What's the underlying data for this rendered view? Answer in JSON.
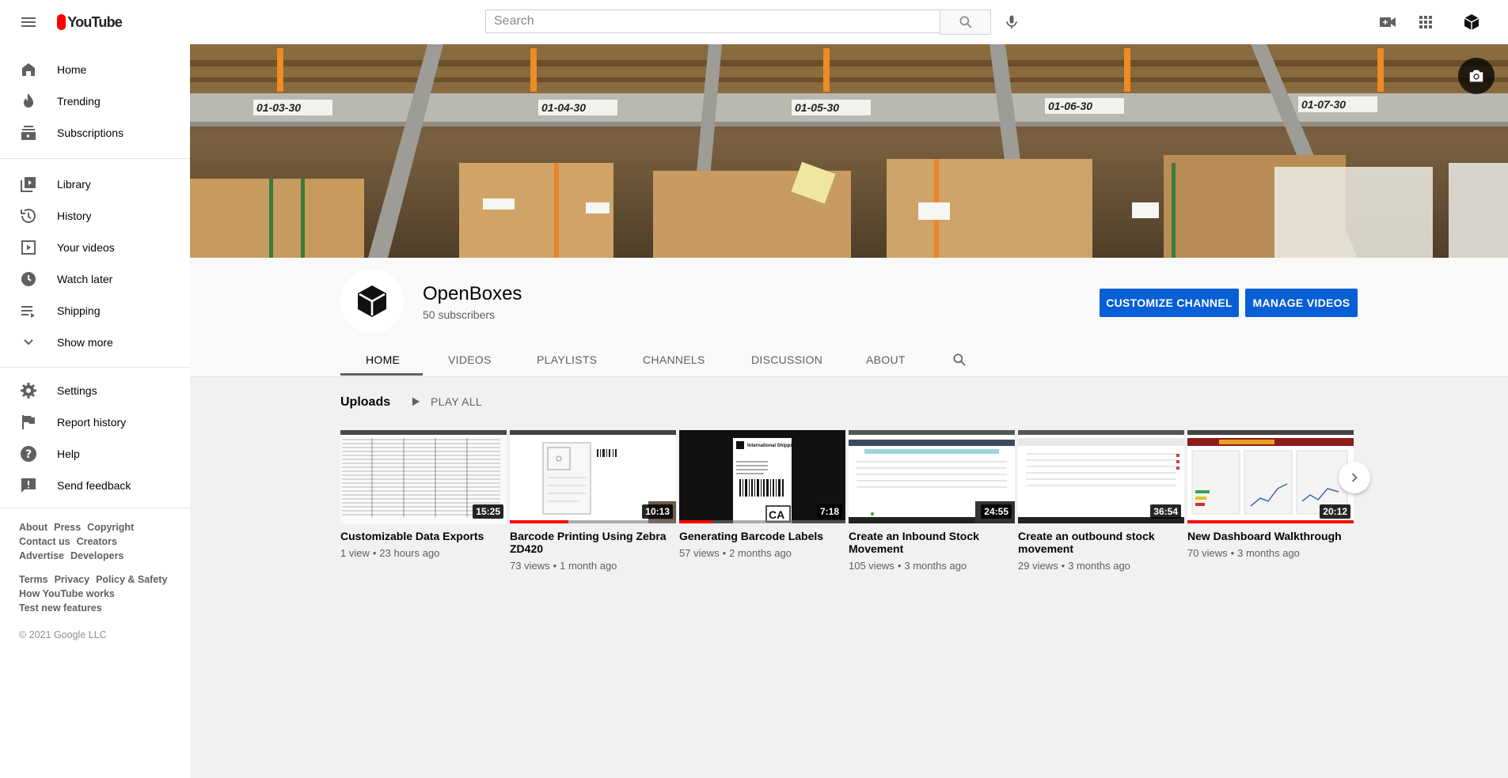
{
  "header": {
    "logo_text": "YouTube",
    "search_placeholder": "Search"
  },
  "sidebar": {
    "primary": [
      {
        "label": "Home",
        "icon": "home-icon"
      },
      {
        "label": "Trending",
        "icon": "trending-icon"
      },
      {
        "label": "Subscriptions",
        "icon": "subscriptions-icon"
      }
    ],
    "secondary": [
      {
        "label": "Library",
        "icon": "library-icon"
      },
      {
        "label": "History",
        "icon": "history-icon"
      },
      {
        "label": "Your videos",
        "icon": "your-videos-icon"
      },
      {
        "label": "Watch later",
        "icon": "watch-later-icon"
      },
      {
        "label": "Shipping",
        "icon": "playlist-icon"
      },
      {
        "label": "Show more",
        "icon": "chevron-down-icon"
      }
    ],
    "tertiary": [
      {
        "label": "Settings",
        "icon": "gear-icon"
      },
      {
        "label": "Report history",
        "icon": "flag-icon"
      },
      {
        "label": "Help",
        "icon": "help-icon"
      },
      {
        "label": "Send feedback",
        "icon": "feedback-icon"
      }
    ],
    "footer_row1": [
      "About",
      "Press",
      "Copyright"
    ],
    "footer_row2": [
      "Contact us",
      "Creators"
    ],
    "footer_row3": [
      "Advertise",
      "Developers"
    ],
    "footer_row4": [
      "Terms",
      "Privacy",
      "Policy & Safety"
    ],
    "footer_row5": [
      "How YouTube works"
    ],
    "footer_row6": [
      "Test new features"
    ],
    "copyright": "© 2021 Google LLC"
  },
  "banner": {
    "shelf_labels": [
      "01-03-30",
      "01-04-30",
      "01-05-30",
      "01-06-30",
      "01-07-30"
    ]
  },
  "channel": {
    "name": "OpenBoxes",
    "subscribers": "50 subscribers",
    "customize_label": "CUSTOMIZE CHANNEL",
    "manage_label": "MANAGE VIDEOS",
    "tabs": [
      "HOME",
      "VIDEOS",
      "PLAYLISTS",
      "CHANNELS",
      "DISCUSSION",
      "ABOUT"
    ],
    "active_tab": "HOME"
  },
  "uploads": {
    "title": "Uploads",
    "play_all": "PLAY ALL",
    "videos": [
      {
        "title": "Customizable Data Exports",
        "views": "1 view",
        "age": "23 hours ago",
        "duration": "15:25",
        "watched": 0
      },
      {
        "title": "Barcode Printing Using Zebra ZD420",
        "views": "73 views",
        "age": "1 month ago",
        "duration": "10:13",
        "watched": 0.35
      },
      {
        "title": "Generating Barcode Labels",
        "views": "57 views",
        "age": "2 months ago",
        "duration": "7:18",
        "watched": 0.2
      },
      {
        "title": "Create an Inbound Stock Movement",
        "views": "105 views",
        "age": "3 months ago",
        "duration": "24:55",
        "watched": 0
      },
      {
        "title": "Create an outbound stock movement",
        "views": "29 views",
        "age": "3 months ago",
        "duration": "36:54",
        "watched": 0
      },
      {
        "title": "New Dashboard Walkthrough",
        "views": "70 views",
        "age": "3 months ago",
        "duration": "20:12",
        "watched": 1.0
      }
    ],
    "thumb_labels": {
      "intl_shipping": "International Shipping",
      "country": "CA"
    }
  },
  "colors": {
    "brand_red": "#ff0000",
    "accent_blue": "#065fd4"
  }
}
